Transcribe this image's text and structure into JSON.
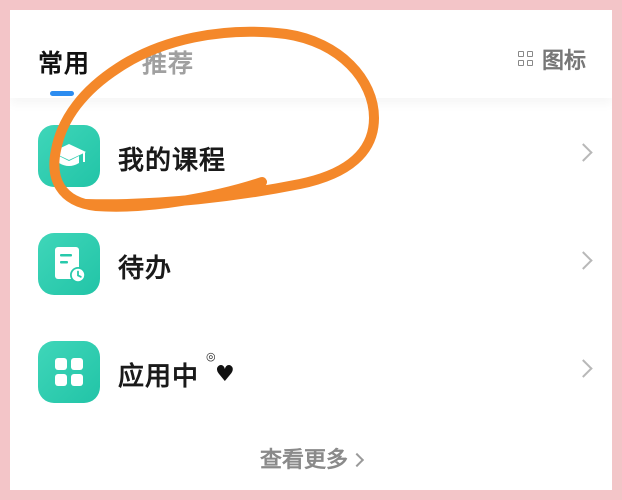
{
  "tabs": {
    "active": "常用",
    "inactive": "推荐",
    "view_toggle_label": "图标",
    "view_toggle_icon": "grid-icon"
  },
  "list": [
    {
      "label": "我的课程",
      "icon": "graduation-cap-icon"
    },
    {
      "label": "待办",
      "icon": "document-clock-icon"
    },
    {
      "label": "应用中",
      "icon": "app-grid-icon"
    }
  ],
  "footer": {
    "more_label": "查看更多"
  },
  "colors": {
    "accent": "#2c8cf0",
    "icon_bg": "#27c9ab",
    "highlight_stroke": "#f4882a",
    "frame": "#f3c5c8"
  }
}
